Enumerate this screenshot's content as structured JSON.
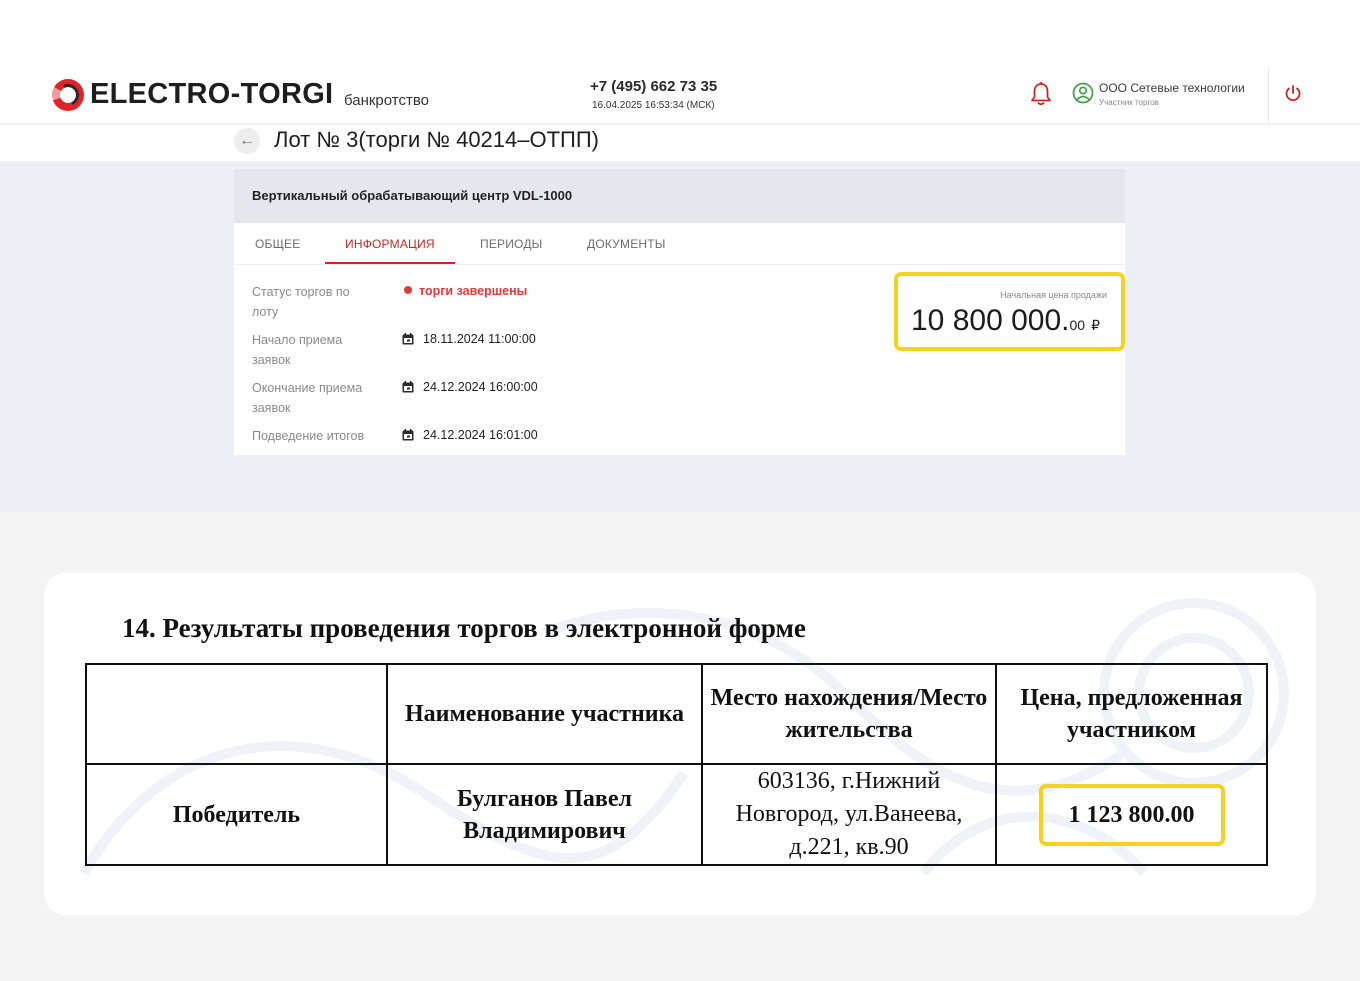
{
  "header": {
    "logo_text": "ELECTRO-TORGI",
    "logo_sub": "банкротство",
    "phone": "+7 (495) 662 73 35",
    "datetime": "16.04.2025 16:53:34 (МСК)",
    "user_name": "ООО Сетевые технологии",
    "user_role": "Участник торгов",
    "icons": [
      "bell-icon",
      "user-circle-icon",
      "power-icon"
    ]
  },
  "lot": {
    "title": "Лот № 3(торги № 40214–ОТПП)",
    "item_name": "Вертикальный обрабатывающий центр VDL-1000",
    "tabs": [
      {
        "label": "ОБЩЕЕ",
        "active": false
      },
      {
        "label": "ИНФОРМАЦИЯ",
        "active": true
      },
      {
        "label": "ПЕРИОДЫ",
        "active": false
      },
      {
        "label": "ДОКУМЕНТЫ",
        "active": false
      }
    ],
    "info": {
      "status_label": "Статус торгов по лоту",
      "status_value": "торги завершены",
      "start_label": "Начало приема заявок",
      "start_value": "18.11.2024 11:00:00",
      "end_label": "Окончание приема заявок",
      "end_value": "24.12.2024 16:00:00",
      "results_label": "Подведение итогов",
      "results_value": "24.12.2024 16:01:00"
    },
    "price": {
      "label": "Начальная цена продажи",
      "main": "10 800 000.",
      "cents": "00",
      "currency": "₽"
    }
  },
  "document": {
    "title": "14. Результаты проведения торгов в электронной форме",
    "headers": [
      "",
      "Наименование участника",
      "Место нахождения/Место жительства",
      "Цена, предложенная участником"
    ],
    "rows": [
      [
        "Победитель",
        "Булганов Павел Владимирович",
        "603136, г.Нижний Новгород, ул.Ванеева, д.221, кв.90",
        "1 123 800.00"
      ]
    ]
  },
  "colors": {
    "accent_red": "#c62828",
    "status_red": "#e53935",
    "highlight_yellow": "#f5d21f",
    "band_blue": "#edf1f7"
  }
}
